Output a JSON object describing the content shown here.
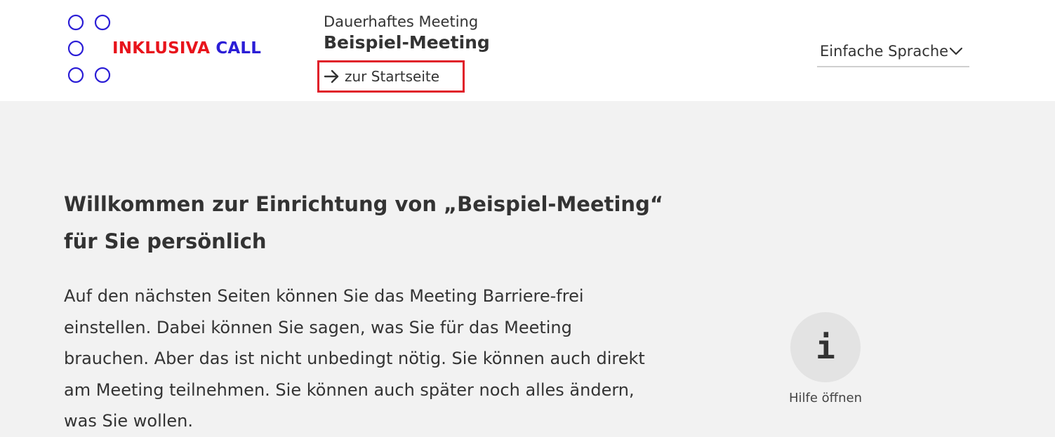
{
  "header": {
    "logo": {
      "word1": "INKLUSIVA",
      "word2": "CALL",
      "icon": "dots-grid-icon",
      "colors": {
        "word1": "#e8141c",
        "word2": "#2b1ed6",
        "dots": "#2b1ed6"
      }
    },
    "meeting": {
      "type": "Dauerhaftes Meeting",
      "name": "Beispiel-Meeting"
    },
    "home_link": {
      "label": "zur Startseite",
      "icon": "arrow-right-icon",
      "highlight_color": "#e0202a"
    },
    "language_select": {
      "value": "Einfache Sprache",
      "icon": "chevron-down-icon"
    }
  },
  "main": {
    "heading": "Willkommen zur Einrichtung von „Beispiel-Meeting“ für Sie persönlich",
    "intro": "Auf den nächsten Seiten können Sie das Meeting Barriere-frei einstellen. Dabei können Sie sagen, was Sie für das Meeting brauchen. Aber das ist nicht unbedingt nötig. Sie können auch direkt am Meeting teilnehmen. Sie können auch später noch alles ändern, was Sie wollen."
  },
  "help": {
    "glyph": "i",
    "label": "Hilfe öffnen",
    "icon": "info-icon"
  }
}
